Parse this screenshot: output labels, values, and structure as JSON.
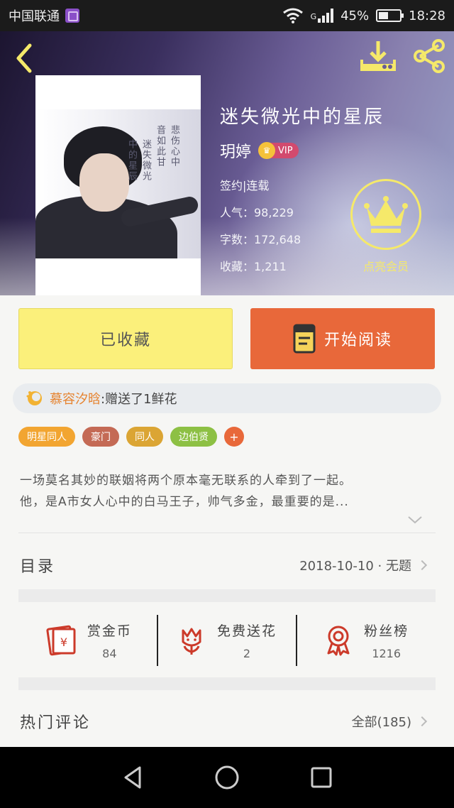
{
  "status_bar": {
    "carrier": "中国联通",
    "network": "G",
    "battery": "45%",
    "battery_level": 0.45,
    "time": "18:28"
  },
  "book": {
    "title": "迷失微光中的星辰",
    "author": "玥婷",
    "vip_label": "VIP",
    "status": "签约|连载",
    "popularity": "人气：98,229",
    "word_count": "字数：172,648",
    "favorites": "收藏：1,211",
    "cover_text_lines": [
      "中的星辰",
      "迷失微光",
      "音如此甘",
      "悲伤心中"
    ]
  },
  "member": {
    "label": "点亮会员"
  },
  "actions": {
    "collected_label": "已收藏",
    "read_label": "开始阅读"
  },
  "gift": {
    "user": "慕容汐晗",
    "message": ":赠送了1鲜花"
  },
  "tags": [
    {
      "label": "明星同人",
      "color": "#f2a531"
    },
    {
      "label": "豪门",
      "color": "#c46a55"
    },
    {
      "label": "同人",
      "color": "#dba534"
    },
    {
      "label": "边伯贤",
      "color": "#8dc044"
    },
    {
      "label": "+",
      "color": "#e8683a"
    }
  ],
  "synopsis": {
    "line1": "一场莫名其妙的联姻将两个原本毫无联系的人牵到了一起。",
    "line2": "他，是A市女人心中的白马王子，帅气多金，最重要的是..."
  },
  "toc": {
    "label": "目录",
    "latest": "2018-10-10 · 无题"
  },
  "stats": [
    {
      "name": "赏金币",
      "value": "84",
      "icon": "red-envelope-icon"
    },
    {
      "name": "免费送花",
      "value": "2",
      "icon": "flower-icon"
    },
    {
      "name": "粉丝榜",
      "value": "1216",
      "icon": "ribbon-medal-icon"
    }
  ],
  "comments": {
    "label": "热门评论",
    "all": "全部(185)"
  },
  "colors": {
    "accent_orange": "#e8683a",
    "collected_yellow": "#fbf07b",
    "member_gold": "#f5e96a",
    "icon_red": "#cc3a2a"
  }
}
